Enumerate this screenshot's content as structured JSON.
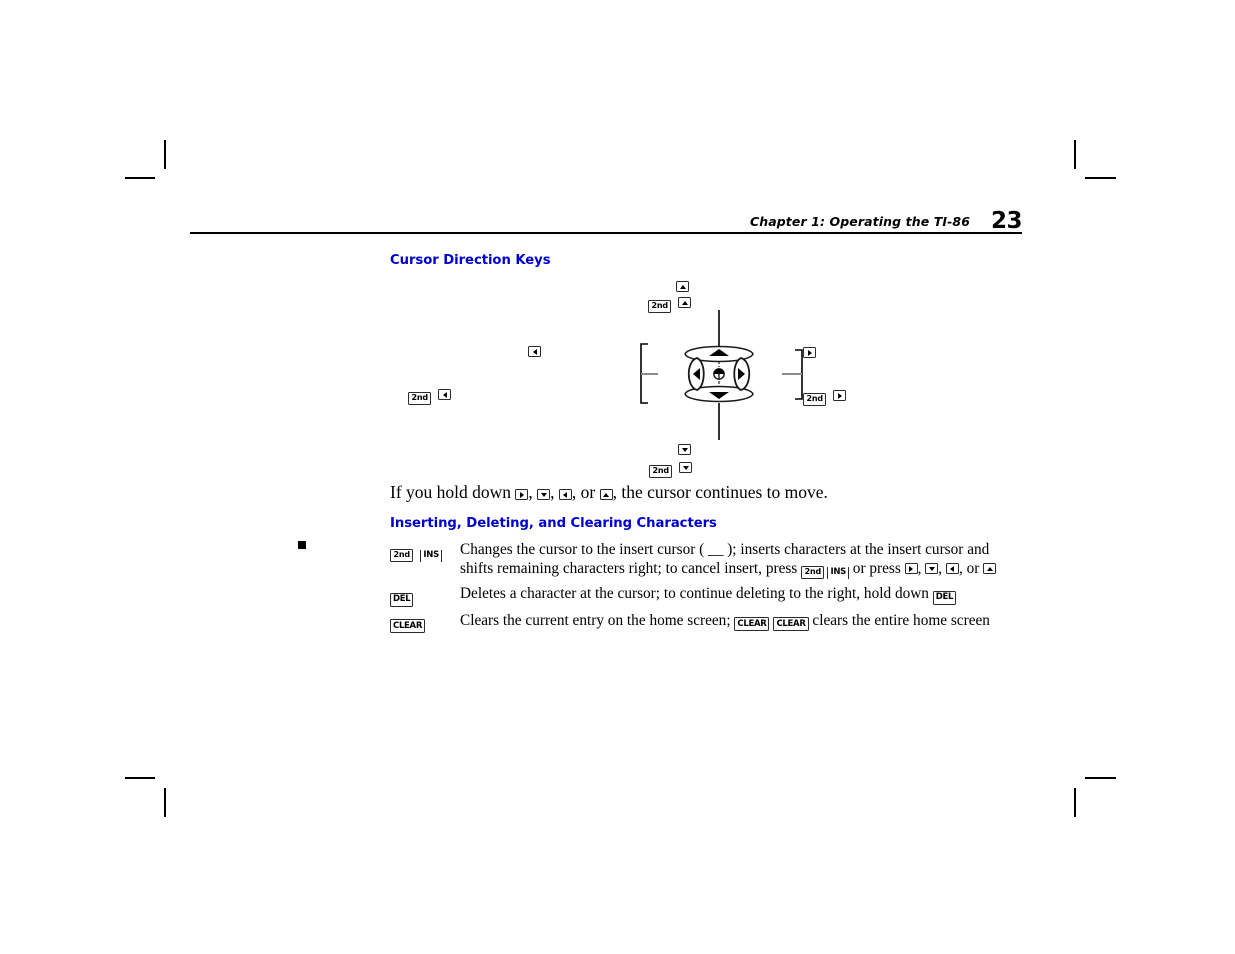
{
  "page": {
    "number": "23",
    "header_text": "Chapter 1:  Operating the TI-86",
    "accent_color": "#0000cd"
  },
  "headings": {
    "cursor_direction_keys": "Cursor Direction Keys",
    "inserting_deleting_clearing": "Inserting, Deleting, and Clearing Characters"
  },
  "keys": {
    "second": "2nd",
    "ins": "INS",
    "del": "DEL",
    "clear": "CLEAR",
    "up": "up-arrow",
    "down": "down-arrow",
    "left": "left-arrow",
    "right": "right-arrow"
  },
  "figure": {
    "name": "cursor-direction-pad-diagram",
    "labels": {
      "top_key": "up-arrow",
      "top_second_key": "2nd",
      "top_second_arrow": "up-arrow",
      "bottom_key": "down-arrow",
      "bottom_second_key": "2nd",
      "bottom_second_arrow": "down-arrow",
      "left_key": "left-arrow",
      "left_second_key": "2nd",
      "left_second_arrow": "left-arrow",
      "right_key": "right-arrow",
      "right_second_key": "2nd",
      "right_second_arrow": "right-arrow"
    }
  },
  "paragraph": {
    "hold_down_prefix": "If you hold down ",
    "sep_1": ", ",
    "sep_2": ", ",
    "sep_3": ", or ",
    "hold_down_suffix": ", the cursor continues to move."
  },
  "definitions": [
    {
      "term_keys": [
        "2nd",
        "INS"
      ],
      "text_1": "Changes the cursor to the insert cursor ( ",
      "text_2": " ); inserts characters at the insert cursor and shifts remaining characters right; to cancel insert, press ",
      "text_3": " or press ",
      "text_4": ", ",
      "text_5": ", ",
      "text_6": ", or "
    },
    {
      "term_keys": [
        "DEL"
      ],
      "text_1": "Deletes a character at the cursor; to continue deleting to the right, hold down "
    },
    {
      "term_keys": [
        "CLEAR"
      ],
      "text_1": "Clears the current entry on the home screen; ",
      "text_2": " clears the entire home screen"
    }
  ]
}
